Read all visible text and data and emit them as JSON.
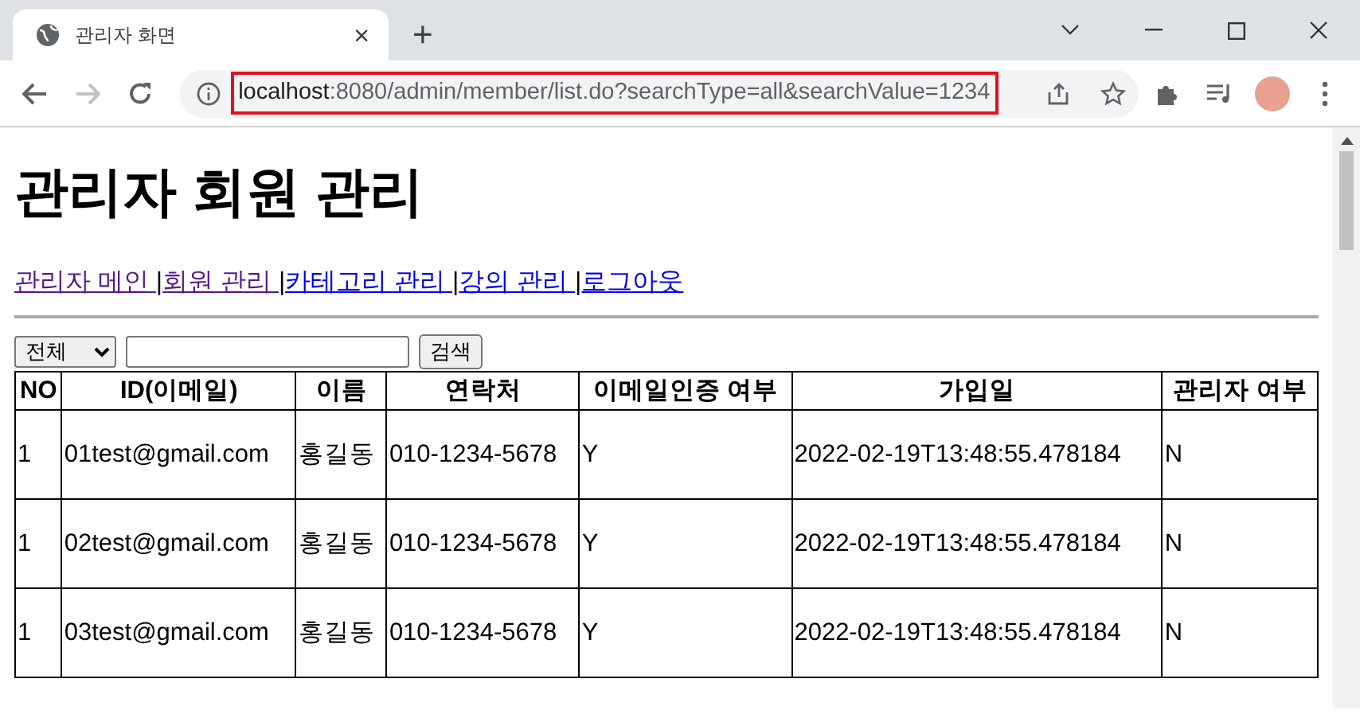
{
  "browser": {
    "tab": {
      "title": "관리자 화면",
      "close": "×",
      "selected": true
    },
    "new_tab": "+",
    "address": {
      "host": "localhost",
      "path": ":8080/admin/member/list.do?searchType=all&searchValue=1234",
      "highlighted": true
    },
    "forward_disabled": true
  },
  "page": {
    "heading": "관리자 회원 관리",
    "nav": [
      {
        "label": "관리자 메인 ",
        "visited": true,
        "separator": "|"
      },
      {
        "label": "회원 관리 ",
        "visited": true,
        "separator": "|"
      },
      {
        "label": "카테고리 관리 ",
        "visited": false,
        "separator": "|"
      },
      {
        "label": "강의 관리 ",
        "visited": false,
        "separator": "|"
      },
      {
        "label": "로그아웃",
        "visited": false
      }
    ],
    "search": {
      "select": "전체",
      "button": "검색"
    },
    "table": {
      "columns": [
        "NO",
        "ID(이메일)",
        "이름",
        "연락처",
        "이메일인증 여부",
        "가입일",
        "관리자 여부"
      ],
      "rows": [
        [
          "1",
          "01test@gmail.com",
          "홍길동",
          "010-1234-5678",
          "Y",
          "2022-02-19T13:48:55.478184",
          "N"
        ],
        [
          "1",
          "02test@gmail.com",
          "홍길동",
          "010-1234-5678",
          "Y",
          "2022-02-19T13:48:55.478184",
          "N"
        ],
        [
          "1",
          "03test@gmail.com",
          "홍길동",
          "010-1234-5678",
          "Y",
          "2022-02-19T13:48:55.478184",
          "N"
        ]
      ]
    }
  }
}
